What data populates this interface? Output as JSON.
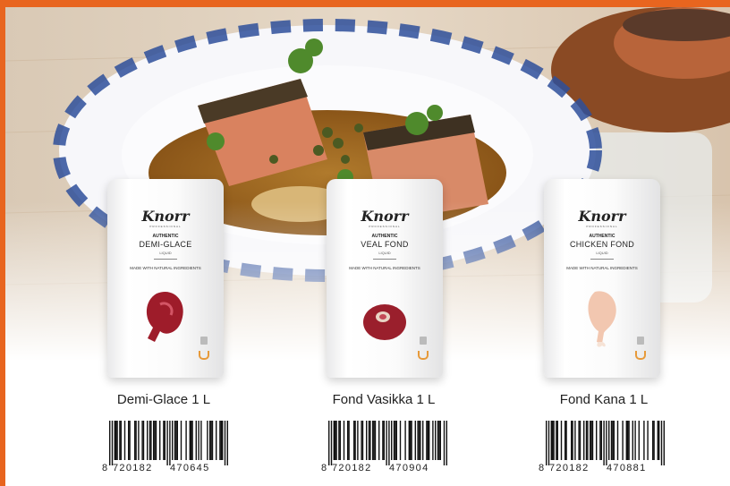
{
  "brand": {
    "name": "Knorr",
    "sub": "PROFESSIONAL",
    "accent_color": "#e8651f"
  },
  "products": [
    {
      "pouch_line1": "AUTHENTIC",
      "pouch_name": "DEMI-GLACE",
      "pouch_type": "LIQUID",
      "pouch_made": "MADE WITH NATURAL INGREDIENTS",
      "pouch_size_badge": "L",
      "caption": "Demi-Glace 1 L",
      "barcode": "8720182470645",
      "barcode_groups": [
        "8",
        "720182",
        "470645"
      ]
    },
    {
      "pouch_line1": "AUTHENTIC",
      "pouch_name": "VEAL FOND",
      "pouch_type": "LIQUID",
      "pouch_made": "MADE WITH NATURAL INGREDIENTS",
      "pouch_size_badge": "L",
      "caption": "Fond Vasikka 1 L",
      "barcode": "8720182470904",
      "barcode_groups": [
        "8",
        "720182",
        "470904"
      ]
    },
    {
      "pouch_line1": "AUTHENTIC",
      "pouch_name": "CHICKEN FOND",
      "pouch_type": "LIQUID",
      "pouch_made": "MADE WITH NATURAL INGREDIENTS",
      "pouch_size_badge": "L",
      "caption": "Fond Kana 1 L",
      "barcode": "8720182470881",
      "barcode_groups": [
        "8",
        "720182",
        "470881"
      ]
    }
  ]
}
